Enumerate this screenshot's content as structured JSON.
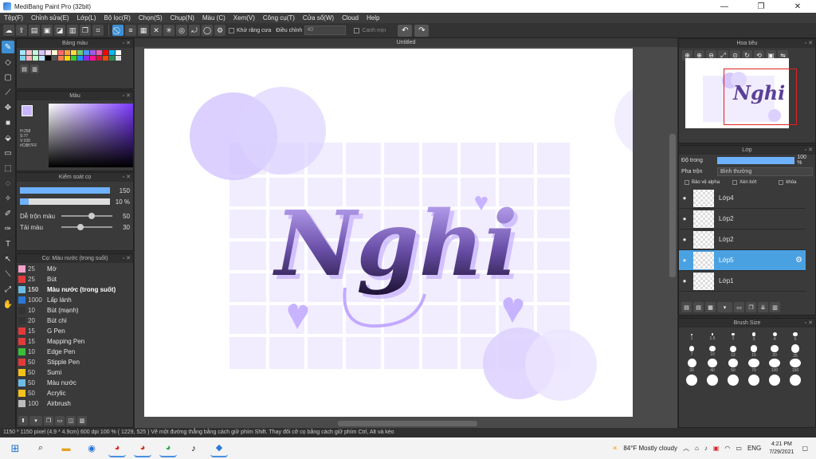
{
  "window": {
    "title": "MediBang Paint Pro (32bit)",
    "buttons": [
      "—",
      "❐",
      "✕"
    ]
  },
  "menu": [
    "Tệp(F)",
    "Chỉnh sửa(E)",
    "Lớp(L)",
    "Bộ lọc(R)",
    "Chọn(S)",
    "Chụp(N)",
    "Màu (C)",
    "Xem(V)",
    "Công cụ(T)",
    "Cửa sổ(W)",
    "Cloud",
    "Help"
  ],
  "toolbar": {
    "antialias_label": "Khử răng cưa",
    "adjust_label": "Điều chỉnh",
    "adjust_value": "40",
    "canh_min_label": "Canh mịn"
  },
  "palette_panel": {
    "title": "Bảng màu"
  },
  "color_panel": {
    "title": "Màu",
    "h": "H:258",
    "s": "S:77",
    "v": "V:100",
    "hex": "#C8B7FF",
    "fg_color": "#c8b7ff"
  },
  "brush_control": {
    "title": "Kiểm soát cọ",
    "size_value": "150",
    "opacity_value": "10 %",
    "blend_label": "Dễ trộn màu",
    "blend_value": "50",
    "amount_label": "Tải màu",
    "amount_value": "30"
  },
  "brush_list": {
    "title": "Cọ: Màu nước (trong suốt)",
    "items": [
      {
        "size": "25",
        "name": "Mờ",
        "color": "#f2a1c9"
      },
      {
        "size": "25",
        "name": "Bút",
        "color": "#e33b3b"
      },
      {
        "size": "150",
        "name": "Màu nước (trong suốt)",
        "color": "#6cbde6"
      },
      {
        "size": "1000",
        "name": "Lấp lánh",
        "color": "#2a78d6"
      },
      {
        "size": "10",
        "name": "Bút (mạnh)",
        "color": "#333333"
      },
      {
        "size": "20",
        "name": "Bút chì",
        "color": "#333333"
      },
      {
        "size": "15",
        "name": "G Pen",
        "color": "#e33b3b"
      },
      {
        "size": "15",
        "name": "Mapping Pen",
        "color": "#e33b3b"
      },
      {
        "size": "10",
        "name": "Edge Pen",
        "color": "#3bbf3b"
      },
      {
        "size": "50",
        "name": "Stipple Pen",
        "color": "#e33b3b"
      },
      {
        "size": "50",
        "name": "Sumi",
        "color": "#f3c21c"
      },
      {
        "size": "50",
        "name": "Màu nước",
        "color": "#6cbde6"
      },
      {
        "size": "50",
        "name": "Acrylic",
        "color": "#f3c21c"
      },
      {
        "size": "100",
        "name": "Airbrush",
        "color": "#bbbbbb"
      }
    ]
  },
  "canvas": {
    "tab_title": "Untitled",
    "lettering": "Nghi"
  },
  "navigator": {
    "title": "Hoa tiêu"
  },
  "layers_panel": {
    "title": "Lớp",
    "opacity_label": "Độ trong",
    "opacity_value": "100 %",
    "blend_label": "Pha trộn",
    "blend_value": "Bình thường",
    "protect_alpha_label": "Bảo vệ alpha",
    "clip_label": "Xén bớt",
    "lock_label": "khóa",
    "layers": [
      {
        "name": "Lớp4",
        "active": false
      },
      {
        "name": "Lớp2",
        "active": false
      },
      {
        "name": "Lớp2",
        "active": false
      },
      {
        "name": "Lớp5",
        "active": true
      },
      {
        "name": "Lớp1",
        "active": false
      }
    ]
  },
  "brush_size_panel": {
    "title": "Brush Size",
    "sizes": [
      "1",
      "1.5",
      "2",
      "3",
      "4",
      "5",
      "7",
      "10",
      "12",
      "15",
      "20",
      "25",
      "30",
      "40",
      "50",
      "70",
      "100",
      "150",
      "",
      "",
      "",
      "",
      "",
      ""
    ]
  },
  "statusbar": {
    "text": "1150 * 1150 pixel   (4.9 * 4.9cm)   600 dpi   100 %   ( 1229, 525 )   Vẽ một đường thẳng bằng cách giữ phím Shift. Thay đổi cỡ cọ bằng cách giữ phím Ctrl, Alt và kéo"
  },
  "taskbar": {
    "weather": "84°F  Mostly cloudy",
    "lang": "ENG",
    "time": "4:21 PM",
    "date": "7/29/2021"
  }
}
